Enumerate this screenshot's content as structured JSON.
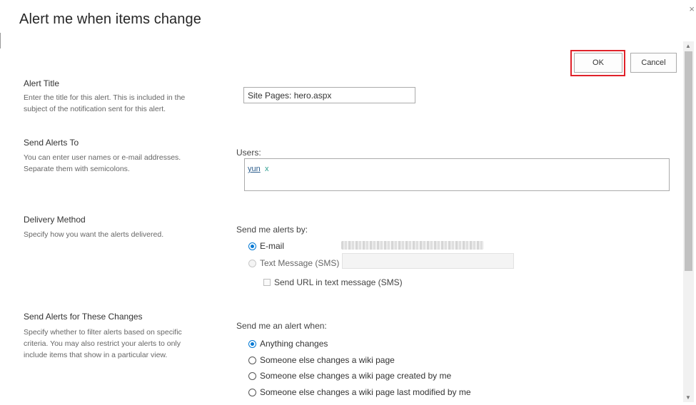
{
  "dialog": {
    "title": "Alert me when items change",
    "close_glyph": "×",
    "ok_label": "OK",
    "cancel_label": "Cancel"
  },
  "sections": {
    "alert_title": {
      "title": "Alert Title",
      "description": "Enter the title for this alert. This is included in the subject of the notification sent for this alert.",
      "input_value": "Site Pages: hero.aspx"
    },
    "send_to": {
      "title": "Send Alerts To",
      "description": "You can enter user names or e-mail addresses. Separate them with semicolons.",
      "field_label": "Users:",
      "user": "yun",
      "remove_glyph": "x"
    },
    "delivery": {
      "title": "Delivery Method",
      "description": "Specify how you want the alerts delivered.",
      "field_label": "Send me alerts by:",
      "options": [
        {
          "label": "E-mail",
          "checked": true
        },
        {
          "label": "Text Message (SMS)",
          "checked": false,
          "disabled": true
        }
      ],
      "sms_url_label": "Send URL in text message (SMS)"
    },
    "changes": {
      "title": "Send Alerts for These Changes",
      "description": "Specify whether to filter alerts based on specific criteria. You may also restrict your alerts to only include items that show in a particular view.",
      "field_label": "Send me an alert when:",
      "options": [
        {
          "label": "Anything changes",
          "checked": true
        },
        {
          "label": "Someone else changes a wiki page",
          "checked": false
        },
        {
          "label": "Someone else changes a wiki page created by me",
          "checked": false
        },
        {
          "label": "Someone else changes a wiki page last modified by me",
          "checked": false
        }
      ]
    }
  },
  "scrollbar": {
    "up_glyph": "▲",
    "down_glyph": "▼"
  },
  "colors": {
    "accent": "#0078d4",
    "highlight_border": "#e0222a",
    "user_link": "#2c5d8c"
  }
}
